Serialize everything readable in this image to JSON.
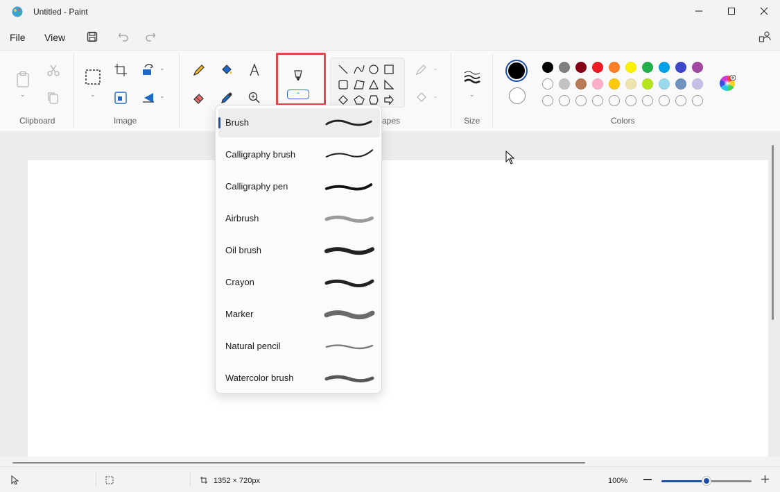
{
  "window": {
    "title": "Untitled - Paint"
  },
  "menu": {
    "file": "File",
    "view": "View"
  },
  "ribbon": {
    "groups": {
      "clipboard": "Clipboard",
      "image": "Image",
      "shapes": "apes",
      "size": "Size",
      "colors": "Colors"
    }
  },
  "colors": {
    "primary": "#000000",
    "secondary": "#ffffff",
    "palette_row1": [
      "#000000",
      "#7f7f7f",
      "#880015",
      "#ed1c24",
      "#ff7f27",
      "#fff200",
      "#22b14c",
      "#00a2e8",
      "#3f48cc",
      "#a349a4"
    ],
    "palette_row2": [
      "#ffffff",
      "#c3c3c3",
      "#b97a57",
      "#ffaec9",
      "#ffc90e",
      "#efe4b0",
      "#b5e61d",
      "#99d9ea",
      "#7092be",
      "#c8bfe7"
    ],
    "palette_row3": [
      "empty",
      "empty",
      "empty",
      "empty",
      "empty",
      "empty",
      "empty",
      "empty",
      "empty",
      "empty"
    ]
  },
  "brush_menu": {
    "items": [
      {
        "label": "Brush",
        "icon": "brush-stroke",
        "selected": true
      },
      {
        "label": "Calligraphy brush",
        "icon": "calligraphy-brush-stroke",
        "selected": false
      },
      {
        "label": "Calligraphy pen",
        "icon": "calligraphy-pen-stroke",
        "selected": false
      },
      {
        "label": "Airbrush",
        "icon": "airbrush-stroke",
        "selected": false
      },
      {
        "label": "Oil brush",
        "icon": "oil-brush-stroke",
        "selected": false
      },
      {
        "label": "Crayon",
        "icon": "crayon-stroke",
        "selected": false
      },
      {
        "label": "Marker",
        "icon": "marker-stroke",
        "selected": false
      },
      {
        "label": "Natural pencil",
        "icon": "natural-pencil-stroke",
        "selected": false
      },
      {
        "label": "Watercolor brush",
        "icon": "watercolor-brush-stroke",
        "selected": false
      }
    ]
  },
  "status": {
    "canvas_size": "1352 × 720px",
    "zoom": "100%",
    "zoom_level": 0.5
  },
  "accent": "#1e4fa8",
  "highlight": "#e04a4a"
}
